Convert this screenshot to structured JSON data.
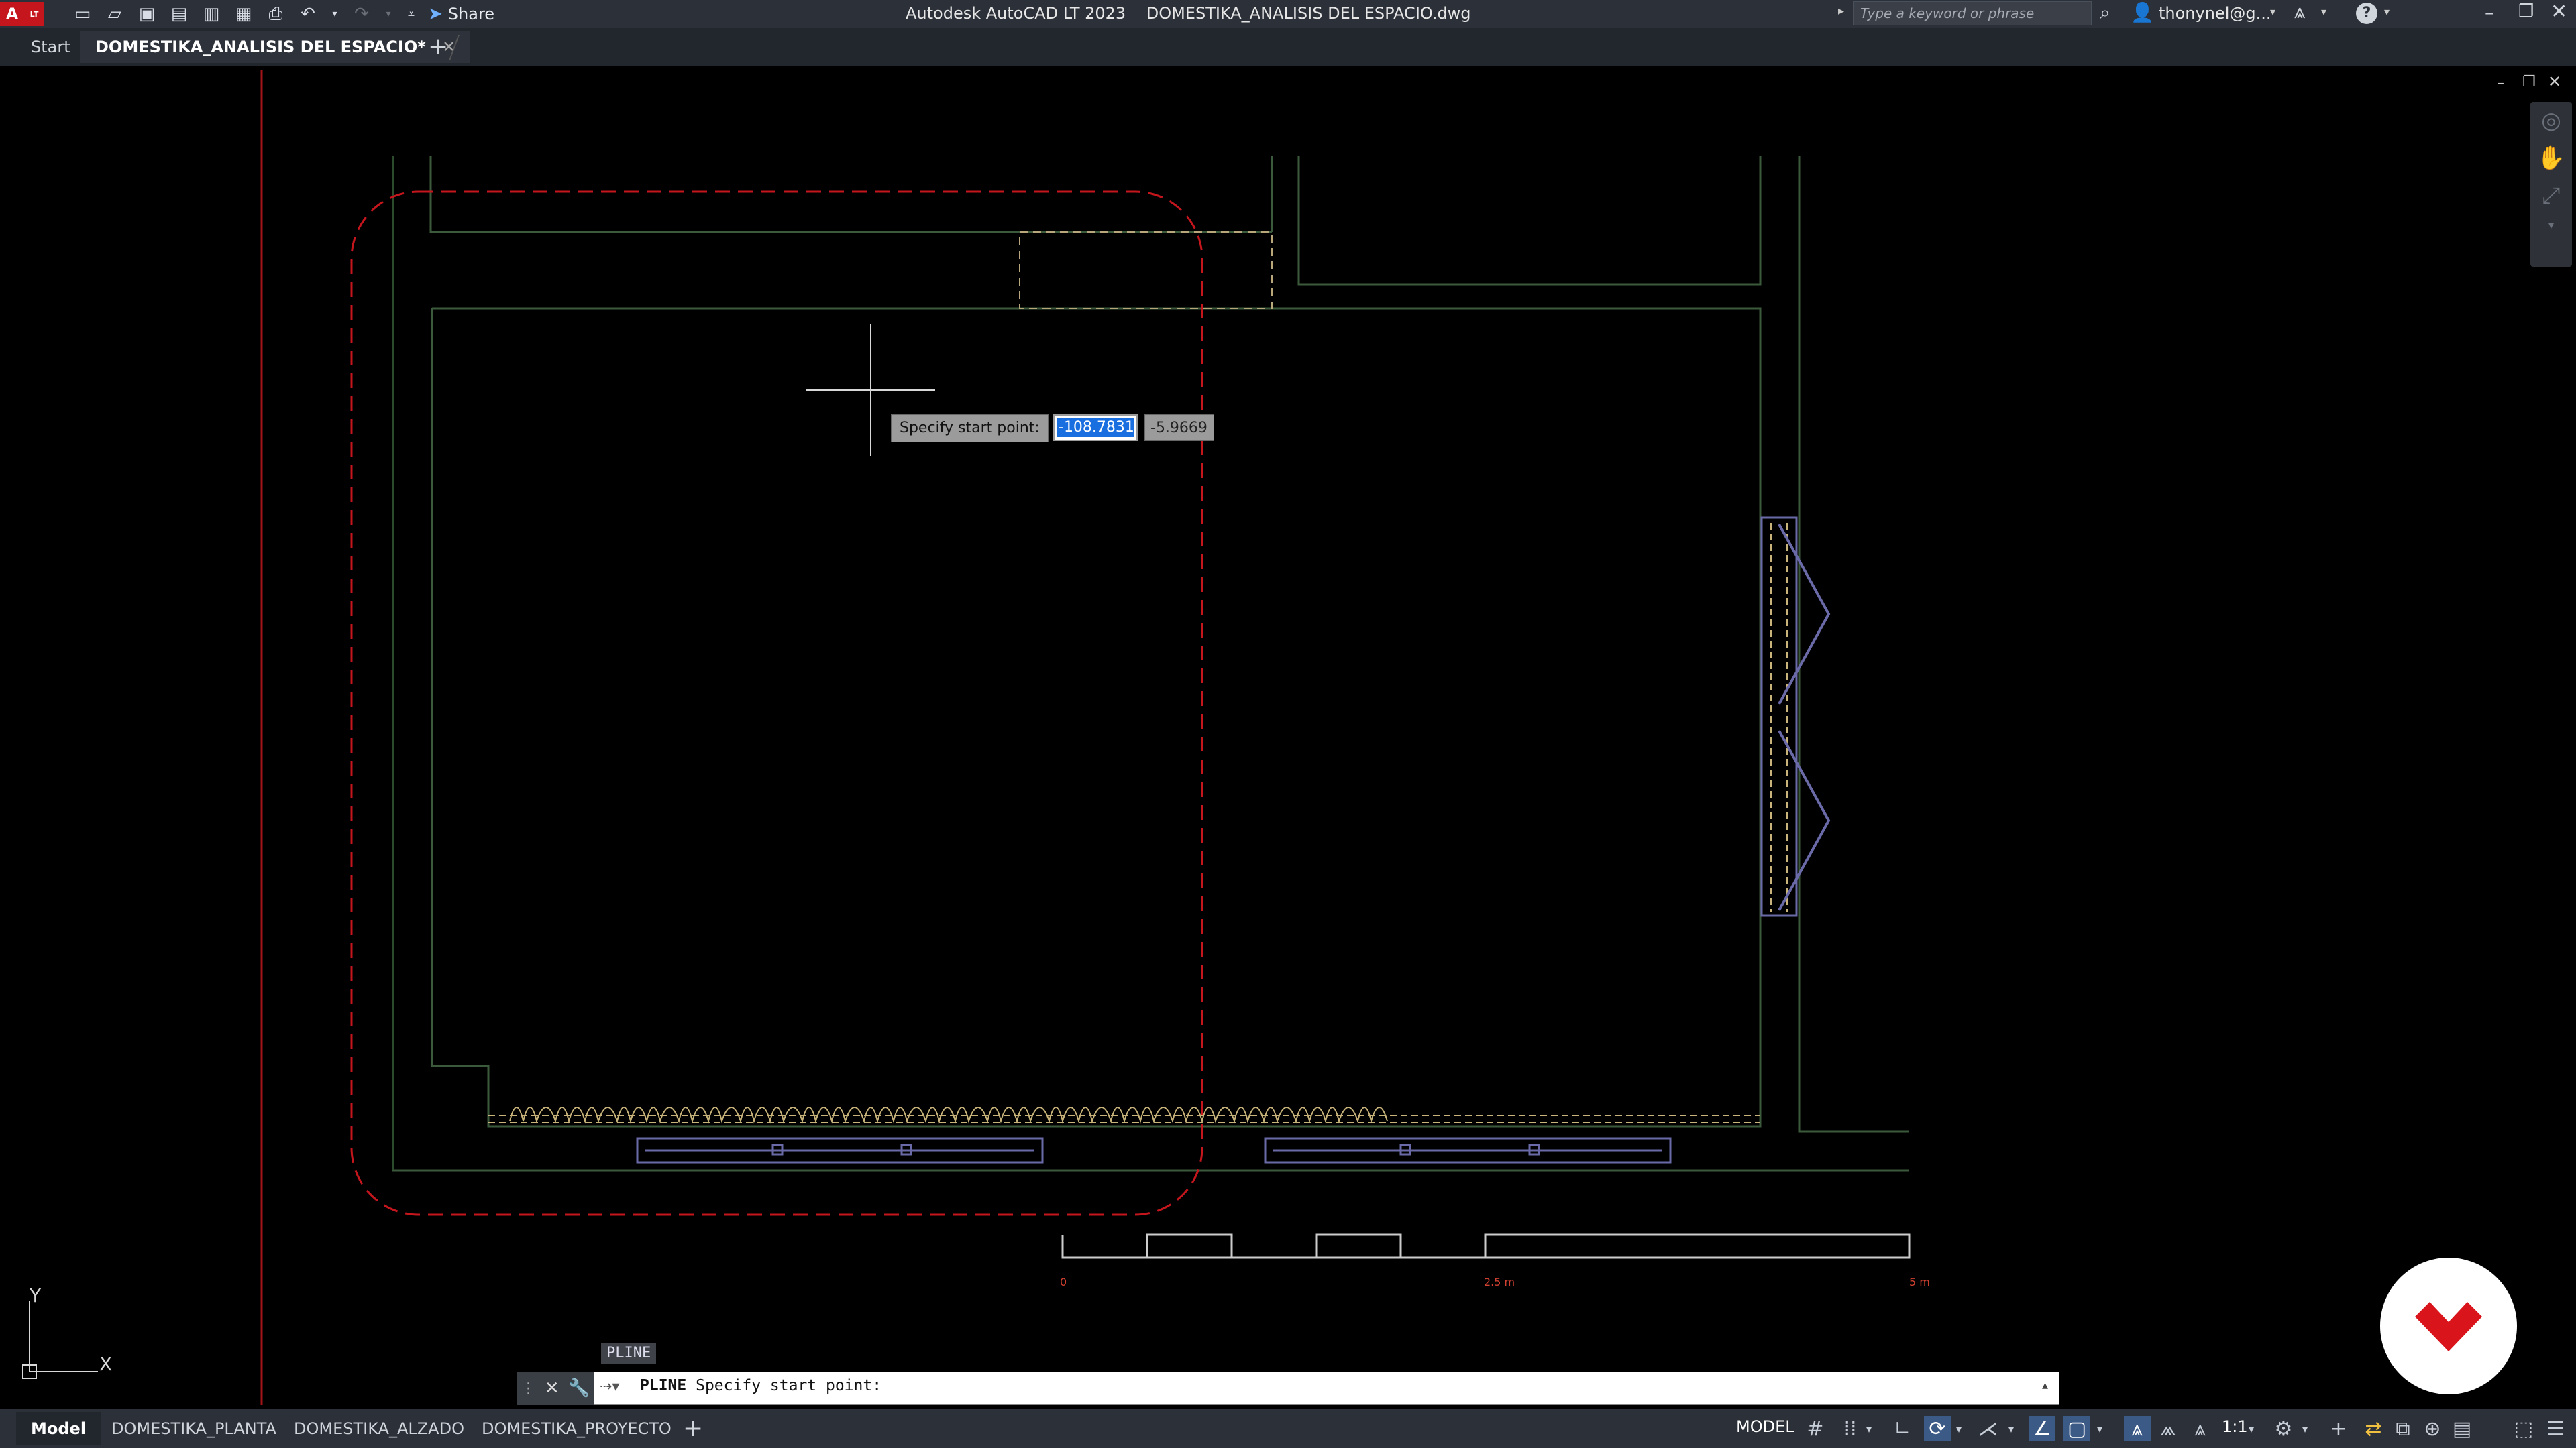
{
  "title_bar": {
    "app_name": "Autodesk AutoCAD LT 2023",
    "file_name": "DOMESTIKA_ANALISIS DEL ESPACIO.dwg",
    "logo_text": "A",
    "badge_text": "LT",
    "share_label": "Share",
    "search_placeholder": "Type a keyword or phrase",
    "user_name": "thonynel@g...",
    "help_label": "?"
  },
  "doc_tabs": {
    "start": "Start",
    "active": "DOMESTIKA_ANALISIS DEL ESPACIO*",
    "new_tab": "+"
  },
  "tooltip": {
    "prompt": "Specify start point:",
    "x_value": "-108.7831",
    "y_value": "-5.9669"
  },
  "scale_bar": {
    "label_0": "0",
    "label_mid": "2.5 m",
    "label_end": "5 m"
  },
  "ucs": {
    "x_label": "X",
    "y_label": "Y"
  },
  "command_line": {
    "last_command_tag": "PLINE",
    "command": "PLINE",
    "prompt": "Specify start point:"
  },
  "layout_tabs": [
    "Model",
    "DOMESTIKA_PLANTA",
    "DOMESTIKA_ALZADO",
    "DOMESTIKA_PROYECTO"
  ],
  "layout_add": "+",
  "status_bar": {
    "model_label": "MODEL",
    "scale": "1:1"
  },
  "colors": {
    "wall": "#2f4a2f",
    "dashed_red": "#c4161c",
    "dashed_yellow": "#c8b47a",
    "furniture": "#6a6aa8",
    "accent": "#1a6fe0"
  }
}
